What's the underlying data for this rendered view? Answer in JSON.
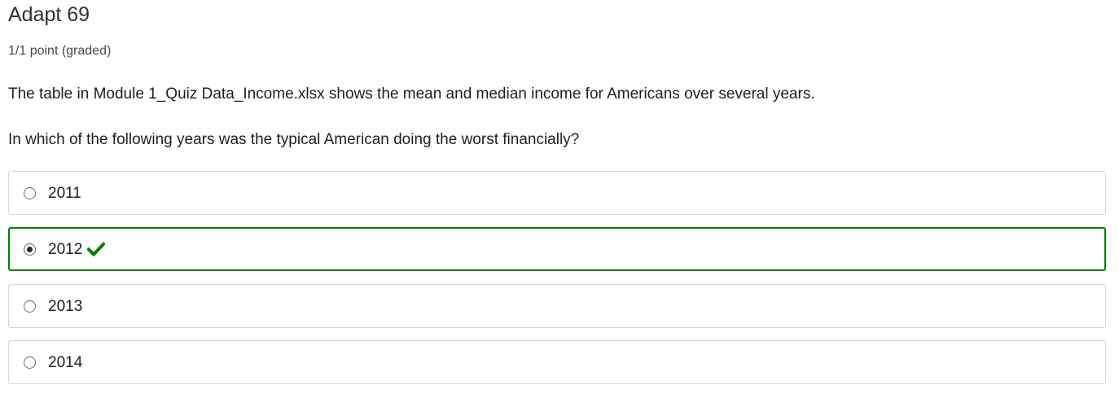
{
  "problem": {
    "title": "Adapt 69",
    "points": "1/1 point (graded)",
    "paragraph1": "The table in Module 1_Quiz Data_Income.xlsx shows the mean and median income for Americans over several years.",
    "question": "In which of the following years was the typical American doing the worst financially?"
  },
  "choices": [
    {
      "label": "2011",
      "selected": false,
      "status": ""
    },
    {
      "label": "2012",
      "selected": true,
      "status": "correct",
      "status_icon": "check-icon"
    },
    {
      "label": "2013",
      "selected": false,
      "status": ""
    },
    {
      "label": "2014",
      "selected": false,
      "status": ""
    }
  ],
  "colors": {
    "correct": "#008100",
    "border": "#d6d6d6",
    "text": "#313131"
  }
}
